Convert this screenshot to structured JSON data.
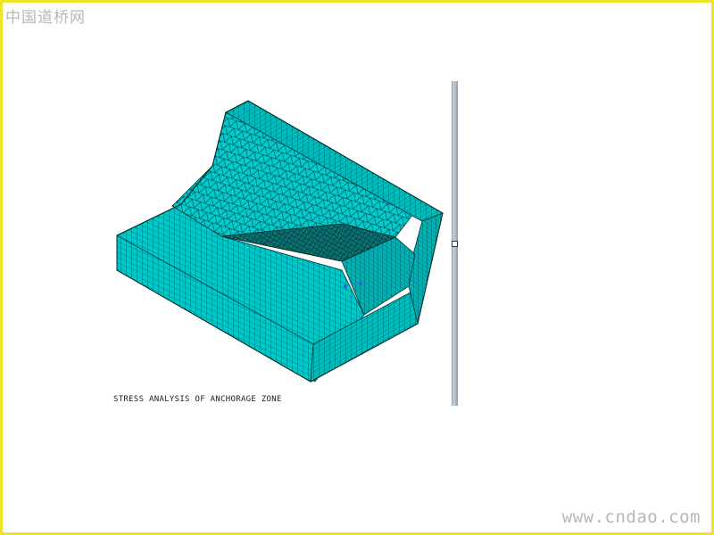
{
  "watermark_top": "中国道桥网",
  "watermark_bottom": "www.cndao.com",
  "model": {
    "caption": "STRESS ANALYSIS OF ANCHORAGE ZONE",
    "mesh_color": "#00c8c8",
    "edge_color": "#003030"
  },
  "colors": {
    "border": "#f0e42a",
    "background": "#ffffff"
  }
}
